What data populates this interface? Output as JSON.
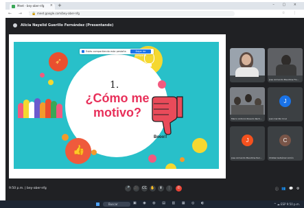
{
  "browser": {
    "tab_title": "Meet - bey-aber-nfg",
    "tab_close": "×",
    "new_tab": "+",
    "window_controls": "– ▢ ×",
    "nav_buttons": "← → ↻",
    "lock": "🔒",
    "url": "meet.google.com/bey-aber-nfg",
    "extensions": "☆ ⋮"
  },
  "meet": {
    "presenter_label": "Alicia Nayelid Guerillo Fernández (Presentando)",
    "share_notice": "Estás compartiendo esta pestaña",
    "share_button": "Dejar de compartir",
    "slide": {
      "number": "1.",
      "title": "¿Cómo me\nmotivo?",
      "sound_text": "Booo!!"
    },
    "participants": [
      {
        "name": "",
        "kind": "photo",
        "photo_color": "#9aa3ad"
      },
      {
        "name": "Jose Armando Maudline Flo...",
        "kind": "photo",
        "photo_color": "#5e6064"
      },
      {
        "name": "Marco Antonio Rosario Rech...",
        "kind": "photo",
        "photo_color": "#7c8086"
      },
      {
        "name": "Juan Carrillo Cruz",
        "kind": "avatar",
        "letter": "J",
        "avatar_color": "#1a73e8"
      },
      {
        "name": "Jose Armando Maudline Peri...",
        "kind": "avatar",
        "letter": "J",
        "avatar_color": "#f4511e"
      },
      {
        "name": "Chikkel Gutiérrez Limón",
        "kind": "avatar",
        "letter": "C",
        "avatar_color": "#795548"
      }
    ],
    "footer": {
      "time_meeting": "9:50 p.m.  |  bey-aber-nfg",
      "controls": [
        "🎤",
        "🎥",
        "CC",
        "✋",
        "⬆",
        "⋮",
        "✆"
      ],
      "right_controls": [
        "ⓘ",
        "👥",
        "💬",
        "⚙"
      ]
    }
  },
  "taskbar": {
    "search_text": "Buscar",
    "apps": "▣ ◉ ◍ ▤ ▥ ▦ ◎ ◐",
    "tray": "^ ☁ ESP  9:50 p.m."
  },
  "colors": {
    "slide_bg": "#28c0c9",
    "title_pink": "#e8305a",
    "meet_bg": "#202124",
    "end_call": "#ea4335"
  }
}
